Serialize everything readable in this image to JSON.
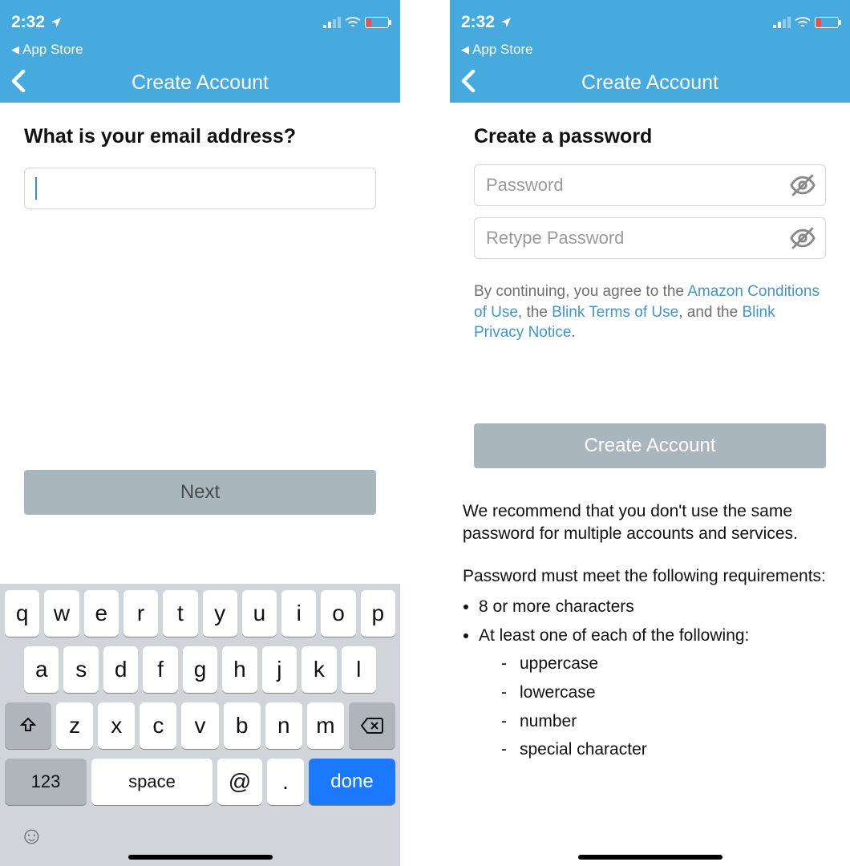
{
  "status": {
    "time": "2:32",
    "back_label": "App Store"
  },
  "nav": {
    "title": "Create Account"
  },
  "left": {
    "heading": "What is your email address?",
    "email_value": "",
    "next_label": "Next"
  },
  "right": {
    "heading": "Create a password",
    "password_placeholder": "Password",
    "retype_placeholder": "Retype Password",
    "terms_prefix": "By continuing, you agree to the ",
    "link1": "Amazon Conditions of Use",
    "sep1": ", the ",
    "link2": "Blink Terms of Use",
    "sep2": ", and the ",
    "link3": "Blink Privacy Notice",
    "terms_suffix": ".",
    "create_label": "Create Account",
    "recommend": "We recommend that you don't use the same password for multiple accounts and services.",
    "req_title": "Password must meet the following requirements:",
    "req1": "8 or more characters",
    "req2": "At least one of each of the following:",
    "sub1": "uppercase",
    "sub2": "lowercase",
    "sub3": "number",
    "sub4": "special character"
  },
  "kbd": {
    "r1": [
      "q",
      "w",
      "e",
      "r",
      "t",
      "y",
      "u",
      "i",
      "o",
      "p"
    ],
    "r2": [
      "a",
      "s",
      "d",
      "f",
      "g",
      "h",
      "j",
      "k",
      "l"
    ],
    "r3": [
      "z",
      "x",
      "c",
      "v",
      "b",
      "n",
      "m"
    ],
    "numkey": "123",
    "space": "space",
    "at": "@",
    "dot": ".",
    "done": "done"
  }
}
